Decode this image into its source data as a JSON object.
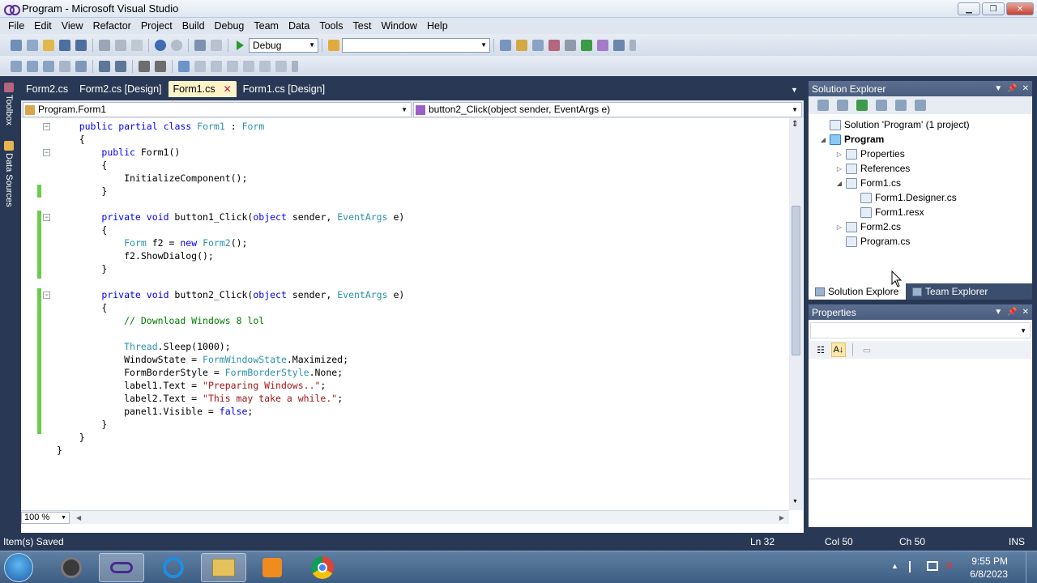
{
  "window": {
    "title": "Program - Microsoft Visual Studio",
    "minimize_glyph": "▁",
    "maximize_glyph": "❐",
    "close_glyph": "✕"
  },
  "menu": [
    "File",
    "Edit",
    "View",
    "Refactor",
    "Project",
    "Build",
    "Debug",
    "Team",
    "Data",
    "Tools",
    "Test",
    "Window",
    "Help"
  ],
  "toolbar": {
    "configuration": "Debug",
    "platform": ""
  },
  "left_dock": {
    "toolbox": "Toolbox",
    "data_sources": "Data Sources"
  },
  "editor_tabs": [
    {
      "label": "Form2.cs",
      "active": false
    },
    {
      "label": "Form2.cs [Design]",
      "active": false
    },
    {
      "label": "Form1.cs",
      "active": true
    },
    {
      "label": "Form1.cs [Design]",
      "active": false
    }
  ],
  "navigation": {
    "type_selector": "Program.Form1",
    "member_selector": "button2_Click(object sender, EventArgs e)"
  },
  "code": {
    "lines": [
      [
        [
          "    ",
          ""
        ],
        [
          "public",
          "kw"
        ],
        [
          " ",
          ""
        ],
        [
          "partial",
          "kw"
        ],
        [
          " ",
          ""
        ],
        [
          "class",
          "kw"
        ],
        [
          " ",
          ""
        ],
        [
          "Form1",
          "ty"
        ],
        [
          " : ",
          ""
        ],
        [
          "Form",
          "ty"
        ]
      ],
      [
        [
          "    {",
          ""
        ]
      ],
      [
        [
          "        ",
          ""
        ],
        [
          "public",
          "kw"
        ],
        [
          " Form1()",
          ""
        ]
      ],
      [
        [
          "        {",
          ""
        ]
      ],
      [
        [
          "            InitializeComponent();",
          ""
        ]
      ],
      [
        [
          "        }",
          ""
        ]
      ],
      [
        [
          "",
          ""
        ]
      ],
      [
        [
          "        ",
          ""
        ],
        [
          "private",
          "kw"
        ],
        [
          " ",
          ""
        ],
        [
          "void",
          "kw"
        ],
        [
          " button1_Click(",
          ""
        ],
        [
          "object",
          "kw"
        ],
        [
          " sender, ",
          ""
        ],
        [
          "EventArgs",
          "ty"
        ],
        [
          " e)",
          ""
        ]
      ],
      [
        [
          "        {",
          ""
        ]
      ],
      [
        [
          "            ",
          ""
        ],
        [
          "Form",
          "ty"
        ],
        [
          " f2 = ",
          ""
        ],
        [
          "new",
          "kw"
        ],
        [
          " ",
          ""
        ],
        [
          "Form2",
          "ty"
        ],
        [
          "();",
          ""
        ]
      ],
      [
        [
          "            f2.ShowDialog();",
          ""
        ]
      ],
      [
        [
          "        }",
          ""
        ]
      ],
      [
        [
          "",
          ""
        ]
      ],
      [
        [
          "        ",
          ""
        ],
        [
          "private",
          "kw"
        ],
        [
          " ",
          ""
        ],
        [
          "void",
          "kw"
        ],
        [
          " button2_Click(",
          ""
        ],
        [
          "object",
          "kw"
        ],
        [
          " sender, ",
          ""
        ],
        [
          "EventArgs",
          "ty"
        ],
        [
          " e)",
          ""
        ]
      ],
      [
        [
          "        {",
          ""
        ]
      ],
      [
        [
          "            ",
          ""
        ],
        [
          "// Download Windows 8 lol",
          "cm"
        ]
      ],
      [
        [
          "",
          ""
        ]
      ],
      [
        [
          "            ",
          ""
        ],
        [
          "Thread",
          "ty"
        ],
        [
          ".Sleep(1000);",
          ""
        ]
      ],
      [
        [
          "            WindowState = ",
          ""
        ],
        [
          "FormWindowState",
          "ty"
        ],
        [
          ".Maximized;",
          ""
        ]
      ],
      [
        [
          "            FormBorderStyle = ",
          ""
        ],
        [
          "FormBorderStyle",
          "ty"
        ],
        [
          ".None;",
          ""
        ]
      ],
      [
        [
          "            label1.Text = ",
          ""
        ],
        [
          "\"Preparing Windows..\"",
          "st"
        ],
        [
          ";",
          ""
        ]
      ],
      [
        [
          "            label2.Text = ",
          ""
        ],
        [
          "\"This may take a while.\"",
          "st"
        ],
        [
          ";",
          ""
        ]
      ],
      [
        [
          "            panel1.Visible = ",
          ""
        ],
        [
          "false",
          "kw"
        ],
        [
          ";",
          ""
        ]
      ],
      [
        [
          "        }",
          ""
        ]
      ],
      [
        [
          "    }",
          ""
        ]
      ],
      [
        [
          "}",
          ""
        ]
      ]
    ]
  },
  "zoom": "100 %",
  "solution_explorer": {
    "title": "Solution Explorer",
    "tree": [
      {
        "label": "Solution 'Program' (1 project)",
        "bold": false,
        "level": 0,
        "expander": ""
      },
      {
        "label": "Program",
        "bold": true,
        "level": 1,
        "expander": "◢"
      },
      {
        "label": "Properties",
        "bold": false,
        "level": 2,
        "expander": "▷"
      },
      {
        "label": "References",
        "bold": false,
        "level": 2,
        "expander": "▷"
      },
      {
        "label": "Form1.cs",
        "bold": false,
        "level": 2,
        "expander": "◢"
      },
      {
        "label": "Form1.Designer.cs",
        "bold": false,
        "level": 3,
        "expander": ""
      },
      {
        "label": "Form1.resx",
        "bold": false,
        "level": 3,
        "expander": ""
      },
      {
        "label": "Form2.cs",
        "bold": false,
        "level": 2,
        "expander": "▷"
      },
      {
        "label": "Program.cs",
        "bold": false,
        "level": 2,
        "expander": ""
      }
    ],
    "tabs": [
      "Solution Explorer",
      "Team Explorer"
    ]
  },
  "properties": {
    "title": "Properties",
    "categorized_glyph": "☷",
    "alphabetical_glyph": "A↓",
    "pages_glyph": "▭"
  },
  "status": {
    "message": "Item(s) Saved",
    "ln": "Ln 32",
    "col": "Col 50",
    "ch": "Ch 50",
    "mode": "INS"
  },
  "taskbar": {
    "time": "9:55 PM",
    "date": "6/8/2023"
  },
  "colors": {
    "chrome": "#293955",
    "active_tab": "#fdf3c9",
    "keyword": "#0000ff",
    "type": "#2b91af",
    "comment": "#008000",
    "string": "#a31515",
    "changed_lines": "#6ccb4c"
  }
}
